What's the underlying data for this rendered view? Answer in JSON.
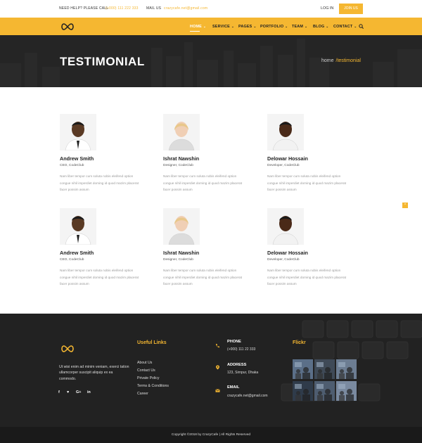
{
  "topbar": {
    "help_label": "NEED HELP? PLEASE CALL",
    "help_phone": "(+000) 111 222 333",
    "mail_label": "MAIL US",
    "mail_value": "crazycafe.net@gmail.com",
    "login": "LOG IN",
    "join": "JOIN US"
  },
  "nav": {
    "items": [
      {
        "label": "HOME",
        "active": true
      },
      {
        "label": "SERVICE"
      },
      {
        "label": "PAGES"
      },
      {
        "label": "PORTFOLIO"
      },
      {
        "label": "TEAM"
      },
      {
        "label": "BLOG"
      },
      {
        "label": "CONTACT"
      }
    ],
    "chevron": "⌄"
  },
  "hero": {
    "title": "TESTIMONIAL",
    "crumb_home": "home",
    "crumb_sep": "/",
    "crumb_current": "testimonial"
  },
  "testimonials": [
    {
      "name": "Andrew Smith",
      "role": "CEO, CodeClub",
      "bio": "Nam liber tempor cum soluta nobis eleifend option congue nihil imperdiet doming id quod mazim placerat facer possim assum"
    },
    {
      "name": "Ishrat Nawshin",
      "role": "Designer, CodeClub",
      "bio": "Nam liber tempor cum soluta nobis eleifend option congue nihil imperdiet doming id quod mazim placerat facer possim assum"
    },
    {
      "name": "Delowar Hossain",
      "role": "Developer, CodeClub",
      "bio": "Nam liber tempor cum soluta nobis eleifend option congue nihil imperdiet doming id quod mazim placerat facer possim assum"
    },
    {
      "name": "Andrew Smith",
      "role": "CEO, CodeClub",
      "bio": "Nam liber tempor cum soluta nobis eleifend option congue nihil imperdiet doming id quod mazim placerat facer possim assum"
    },
    {
      "name": "Ishrat Nawshin",
      "role": "Designer, CodeClub",
      "bio": "Nam liber tempor cum soluta nobis eleifend option congue nihil imperdiet doming id quod mazim placerat facer possim assum"
    },
    {
      "name": "Delowar Hossain",
      "role": "Developer, CodeClub",
      "bio": "Nam liber tempor cum soluta nobis eleifend option congue nihil imperdiet doming id quod mazim placerat facer possim assum"
    }
  ],
  "scroll_top_icon": "^",
  "footer": {
    "about": "Ut wisi enim ad minim veniam, exerci tation ullamcorper suscipit aliquip ex ea commodo.",
    "social": [
      {
        "icon": "f",
        "name": "facebook-icon"
      },
      {
        "icon": "♥",
        "name": "twitter-icon"
      },
      {
        "icon": "G+",
        "name": "google-plus-icon"
      },
      {
        "icon": "in",
        "name": "linkedin-icon"
      }
    ],
    "useful_links_title": "Useful Links",
    "links": [
      "About Us",
      "Contact Us",
      "Private Policy",
      "Terms & Conditions",
      "Career"
    ],
    "phone_label": "PHONE",
    "phone_value": "(+000) 111 22 333",
    "address_label": "ADDRESS",
    "address_value": "123, Sirnpur, Dhaka",
    "email_label": "EMAIL",
    "email_value": "crazycafe.net@gmail.com",
    "flickr_title": "Flickr",
    "copyright": "Copyright ©2018 by CrazyCafe   |   All Rights Reserved"
  },
  "colors": {
    "accent": "#f5b731",
    "dark": "#222222",
    "hero": "#2b2b2b"
  }
}
